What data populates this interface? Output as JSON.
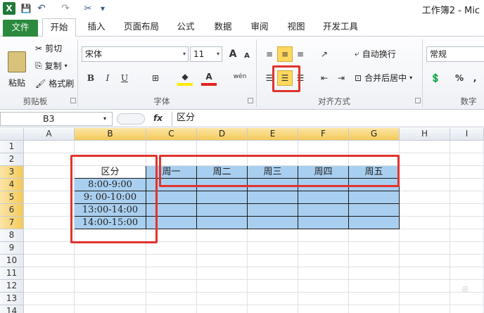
{
  "title": "工作簿2 - Mic",
  "quick_access": {
    "logo": "X",
    "save_icon": "💾",
    "undo_icon": "↶",
    "redo_icon": "↷",
    "customize_icon": "▾"
  },
  "tabs": [
    "文件",
    "开始",
    "插入",
    "页面布局",
    "公式",
    "数据",
    "审阅",
    "视图",
    "开发工具"
  ],
  "clipboard": {
    "paste": "粘贴",
    "cut": "剪切",
    "copy": "复制",
    "format_painter": "格式刷",
    "group": "剪贴板"
  },
  "font": {
    "name": "宋体",
    "size": "11",
    "bold": "B",
    "italic": "I",
    "underline": "U",
    "grow": "A",
    "shrink": "A",
    "wen": "wén",
    "group": "字体"
  },
  "alignment": {
    "wrap_text": "自动换行",
    "merge_center": "合并后居中",
    "group": "对齐方式"
  },
  "number": {
    "format": "常规",
    "percent": "%",
    "comma": ",",
    "group": "数字"
  },
  "formula_bar": {
    "name_box": "B3",
    "fx": "fx",
    "value": "区分"
  },
  "columns": [
    "A",
    "B",
    "C",
    "D",
    "E",
    "F",
    "G",
    "H",
    "I"
  ],
  "rows": [
    "1",
    "2",
    "3",
    "4",
    "5",
    "6",
    "7",
    "8",
    "9",
    "10",
    "11",
    "12",
    "13",
    "14"
  ],
  "sheet": {
    "header_b3": "区分",
    "weekdays": [
      "周一",
      "周二",
      "周三",
      "周四",
      "周五"
    ],
    "times": [
      "8:00-9:00",
      "9: 00-10:00",
      "13:00-14:00",
      "14:00-15:00"
    ]
  },
  "colors": {
    "selection": "#a9cff0",
    "highlight_box": "#e0342d",
    "file_tab": "#2b8a3e"
  }
}
